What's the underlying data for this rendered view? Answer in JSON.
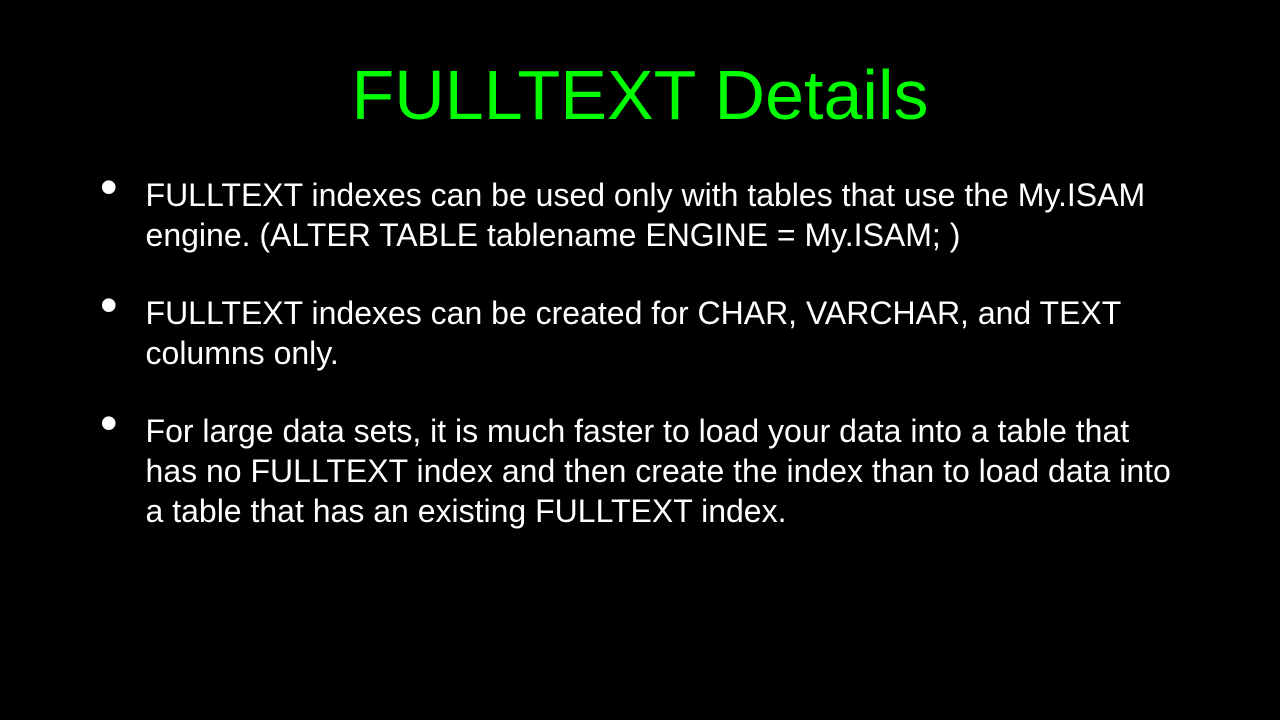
{
  "slide": {
    "title": "FULLTEXT Details",
    "bullets": [
      "FULLTEXT indexes can be used only with tables that use the My.ISAM engine. (ALTER TABLE tablename ENGINE = My.ISAM; )",
      "FULLTEXT indexes can be created for CHAR, VARCHAR, and TEXT columns only.",
      "For large data sets, it is much faster to load your data into a table that has no FULLTEXT index and then create the index than to load data into a table that has an existing FULLTEXT index."
    ]
  }
}
